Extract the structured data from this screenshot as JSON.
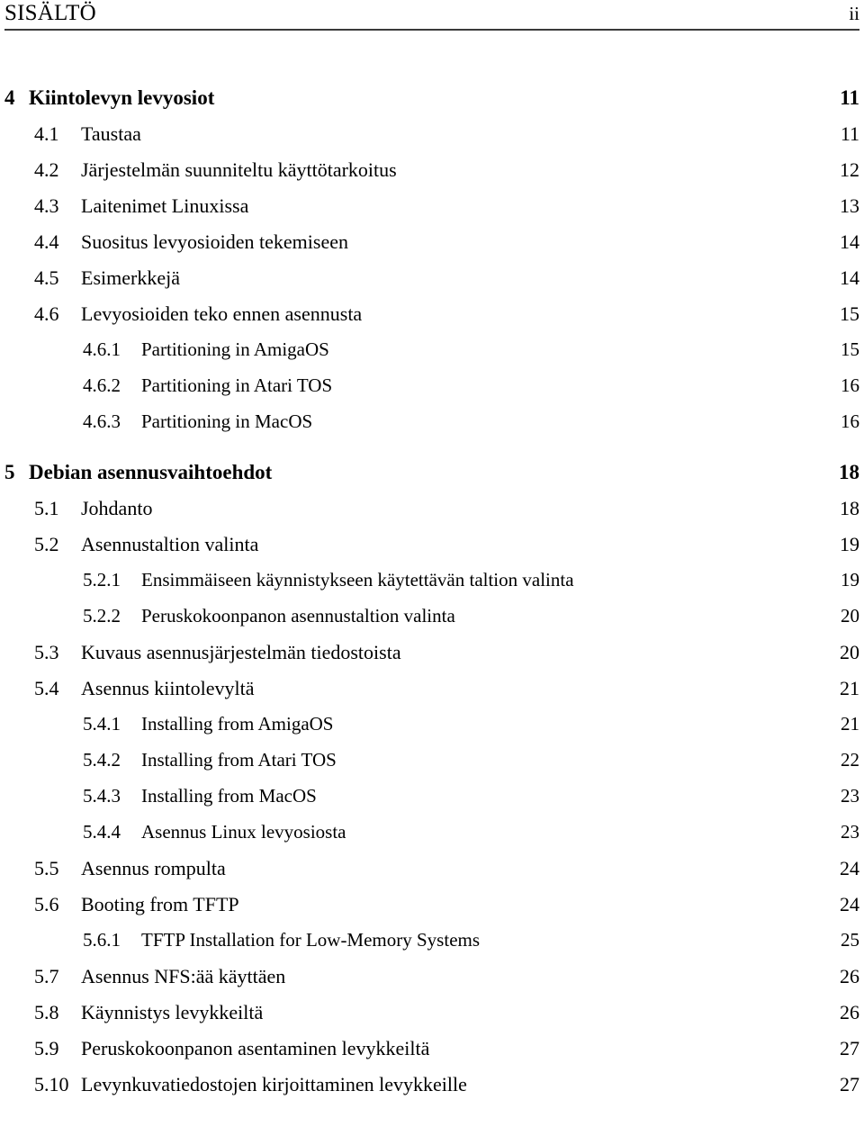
{
  "header": {
    "title": "SISÄLTÖ",
    "page_number": "ii"
  },
  "toc": {
    "entries": [
      {
        "level": 0,
        "number": "4",
        "title": "Kiintolevyn levyosiot",
        "page": "11"
      },
      {
        "level": 1,
        "number": "4.1",
        "title": "Taustaa",
        "page": "11"
      },
      {
        "level": 1,
        "number": "4.2",
        "title": "Järjestelmän suunniteltu käyttötarkoitus",
        "page": "12"
      },
      {
        "level": 1,
        "number": "4.3",
        "title": "Laitenimet Linuxissa",
        "page": "13"
      },
      {
        "level": 1,
        "number": "4.4",
        "title": "Suositus levyosioiden tekemiseen",
        "page": "14"
      },
      {
        "level": 1,
        "number": "4.5",
        "title": "Esimerkkejä",
        "page": "14"
      },
      {
        "level": 1,
        "number": "4.6",
        "title": "Levyosioiden teko ennen asennusta",
        "page": "15"
      },
      {
        "level": 2,
        "number": "4.6.1",
        "title": "Partitioning in AmigaOS",
        "page": "15"
      },
      {
        "level": 2,
        "number": "4.6.2",
        "title": "Partitioning in Atari TOS",
        "page": "16"
      },
      {
        "level": 2,
        "number": "4.6.3",
        "title": "Partitioning in MacOS",
        "page": "16"
      },
      {
        "level": 0,
        "number": "5",
        "title": "Debian asennusvaihtoehdot",
        "page": "18"
      },
      {
        "level": 1,
        "number": "5.1",
        "title": "Johdanto",
        "page": "18"
      },
      {
        "level": 1,
        "number": "5.2",
        "title": "Asennustaltion valinta",
        "page": "19"
      },
      {
        "level": 2,
        "number": "5.2.1",
        "title": "Ensimmäiseen käynnistykseen käytettävän taltion valinta",
        "page": "19"
      },
      {
        "level": 2,
        "number": "5.2.2",
        "title": "Peruskokoonpanon asennustaltion valinta",
        "page": "20"
      },
      {
        "level": 1,
        "number": "5.3",
        "title": "Kuvaus asennusjärjestelmän tiedostoista",
        "page": "20"
      },
      {
        "level": 1,
        "number": "5.4",
        "title": "Asennus kiintolevyltä",
        "page": "21"
      },
      {
        "level": 2,
        "number": "5.4.1",
        "title": "Installing from AmigaOS",
        "page": "21"
      },
      {
        "level": 2,
        "number": "5.4.2",
        "title": "Installing from Atari TOS",
        "page": "22"
      },
      {
        "level": 2,
        "number": "5.4.3",
        "title": "Installing from MacOS",
        "page": "23"
      },
      {
        "level": 2,
        "number": "5.4.4",
        "title": "Asennus Linux levyosiosta",
        "page": "23"
      },
      {
        "level": 1,
        "number": "5.5",
        "title": "Asennus rompulta",
        "page": "24"
      },
      {
        "level": 1,
        "number": "5.6",
        "title": "Booting from TFTP",
        "page": "24"
      },
      {
        "level": 2,
        "number": "5.6.1",
        "title": "TFTP Installation for Low-Memory Systems",
        "page": "25"
      },
      {
        "level": 1,
        "number": "5.7",
        "title": "Asennus NFS:ää käyttäen",
        "page": "26"
      },
      {
        "level": 1,
        "number": "5.8",
        "title": "Käynnistys levykkeiltä",
        "page": "26"
      },
      {
        "level": 1,
        "number": "5.9",
        "title": "Peruskokoonpanon asentaminen levykkeiltä",
        "page": "27"
      },
      {
        "level": 1,
        "number": "5.10",
        "title": "Levynkuvatiedostojen kirjoittaminen levykkeille",
        "page": "27"
      }
    ]
  }
}
